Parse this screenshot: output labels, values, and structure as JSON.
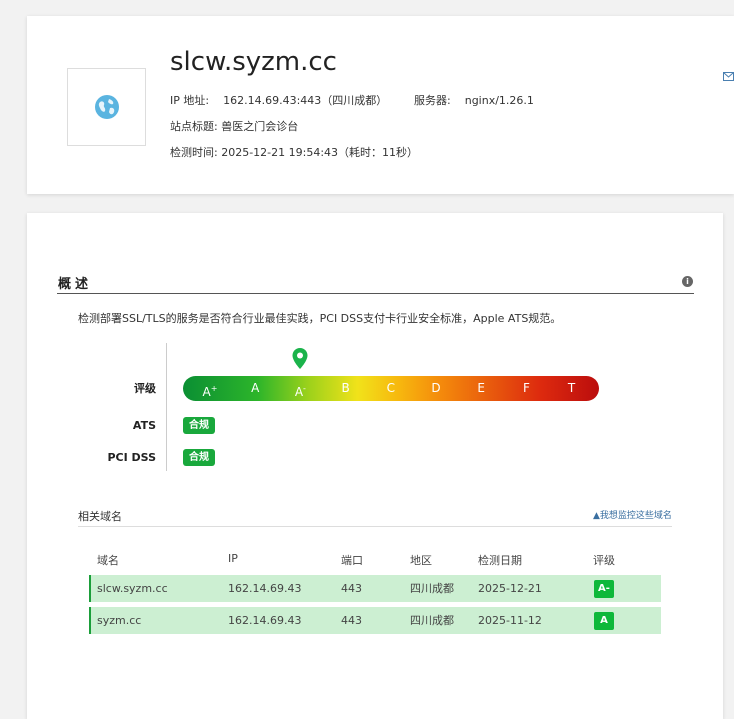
{
  "site": {
    "domain": "slcw.syzm.cc",
    "ip_label": "IP 地址:",
    "ip_value": "162.14.69.43:443（四川成都）",
    "server_label": "服务器:",
    "server_value": "nginx/1.26.1",
    "title_label": "站点标题:",
    "title_value": "兽医之门会诊台",
    "time_label": "检测时间:",
    "time_value": "2025-12-21 19:54:43（耗时：11秒）"
  },
  "overview": {
    "title": "概述",
    "help_icon": "info-icon",
    "description": "检测部署SSL/TLS的服务是否符合行业最佳实践，PCI DSS支付卡行业安全标准，Apple ATS规范。",
    "rating_label": "评级",
    "grades": [
      "A",
      "A",
      "A",
      "B",
      "C",
      "D",
      "E",
      "F",
      "T"
    ],
    "grade_sups": [
      "+",
      "",
      "-",
      "",
      "",
      "",
      "",
      "",
      ""
    ],
    "current_grade_index": 2,
    "ats_label": "ATS",
    "ats_value": "合规",
    "pci_label": "PCI DSS",
    "pci_value": "合规"
  },
  "related": {
    "title": "相关域名",
    "monitor_link": "▲我想监控这些域名",
    "headers": [
      "域名",
      "IP",
      "端口",
      "地区",
      "检测日期",
      "评级"
    ],
    "rows": [
      {
        "domain": "slcw.syzm.cc",
        "ip": "162.14.69.43",
        "port": "443",
        "region": "四川成都",
        "date": "2025-12-21",
        "grade": "A-"
      },
      {
        "domain": "syzm.cc",
        "ip": "162.14.69.43",
        "port": "443",
        "region": "四川成都",
        "date": "2025-11-12",
        "grade": "A"
      }
    ]
  },
  "colors": {
    "pass_badge": "#19a83c",
    "row_bg": "#ccefd2",
    "link": "#3a6fa0"
  }
}
